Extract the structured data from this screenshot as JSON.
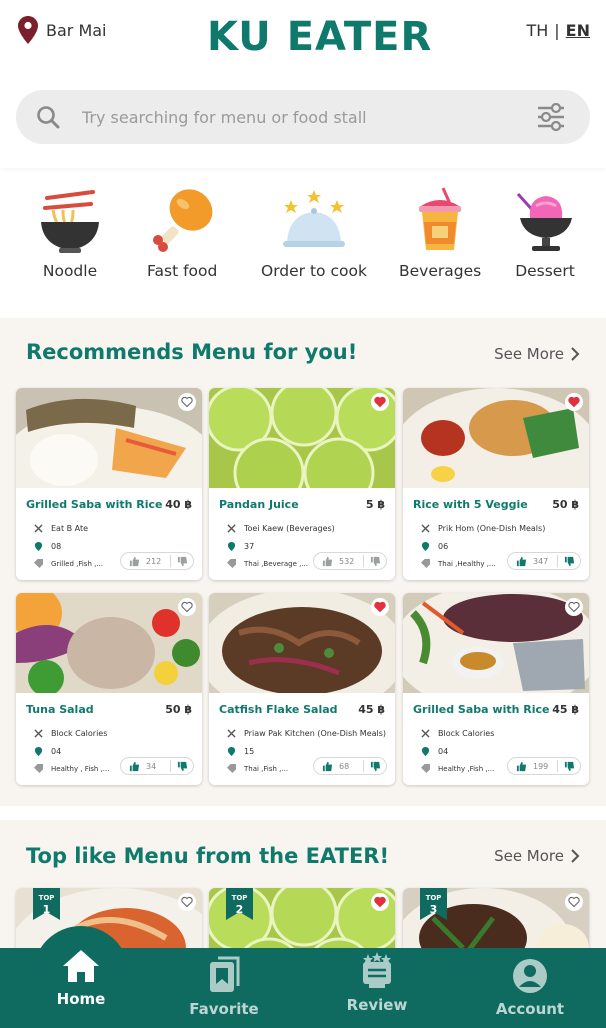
{
  "header": {
    "location": "Bar Mai",
    "logo_text": "KU EATER",
    "lang_th": "TH",
    "lang_sep": "|",
    "lang_en": "EN"
  },
  "search": {
    "placeholder": "Try searching for menu or food stall"
  },
  "categories": [
    {
      "label": "Noodle",
      "icon": "noodle-bowl-icon"
    },
    {
      "label": "Fast food",
      "icon": "chicken-leg-icon"
    },
    {
      "label": "Order to cook",
      "icon": "cloche-icon"
    },
    {
      "label": "Beverages",
      "icon": "drink-cup-icon"
    },
    {
      "label": "Dessert",
      "icon": "ice-cream-icon"
    }
  ],
  "recommends": {
    "title": "Recommends Menu for you!",
    "see_more": "See More",
    "items": [
      {
        "name": "Grilled Saba with Rice",
        "price": "40 ฿",
        "stall": "Eat B Ate",
        "zone": "08",
        "tags": "Grilled ,Fish ,...",
        "likes": "212",
        "favorited": false
      },
      {
        "name": "Pandan Juice",
        "price": "5 ฿",
        "stall": "Toei Kaew (Beverages)",
        "zone": "37",
        "tags": "Thai ,Beverage ,...",
        "likes": "532",
        "favorited": true
      },
      {
        "name": "Rice with 5 Veggie",
        "price": "50 ฿",
        "stall": "Prik Hom (One-Dish Meals)",
        "zone": "06",
        "tags": "Thai ,Healthy ,...",
        "likes": "347",
        "favorited": true
      },
      {
        "name": "Tuna Salad",
        "price": "50 ฿",
        "stall": "Block Calories",
        "zone": "04",
        "tags": "Healthy , Fish ,...",
        "likes": "34",
        "favorited": false
      },
      {
        "name": "Catfish Flake Salad",
        "price": "45 ฿",
        "stall": "Priaw Pak Kitchen (One-Dish Meals)",
        "zone": "15",
        "tags": "Thai ,Fish ,...",
        "likes": "68",
        "favorited": true
      },
      {
        "name": "Grilled Saba with Rice",
        "price": "45 ฿",
        "stall": "Block Calories",
        "zone": "04",
        "tags": "Healthy ,Fish ,...",
        "likes": "199",
        "favorited": false
      }
    ]
  },
  "toplike": {
    "title": "Top like Menu from the EATER!",
    "see_more": "See More",
    "badge_label": "TOP",
    "items": [
      {
        "rank": "1",
        "favorited": false
      },
      {
        "rank": "2",
        "favorited": true
      },
      {
        "rank": "3",
        "favorited": false
      }
    ]
  },
  "bottom_nav": [
    {
      "label": "Home",
      "icon": "home-icon",
      "active": true
    },
    {
      "label": "Favorite",
      "icon": "bookmark-icon",
      "active": false
    },
    {
      "label": "Review",
      "icon": "review-icon",
      "active": false
    },
    {
      "label": "Account",
      "icon": "account-icon",
      "active": false
    }
  ],
  "colors": {
    "brand_green": "#0f7a6c",
    "nav_green": "#0f6b5f",
    "heart_red": "#e0313d",
    "section_bg": "#f8f4f0"
  }
}
